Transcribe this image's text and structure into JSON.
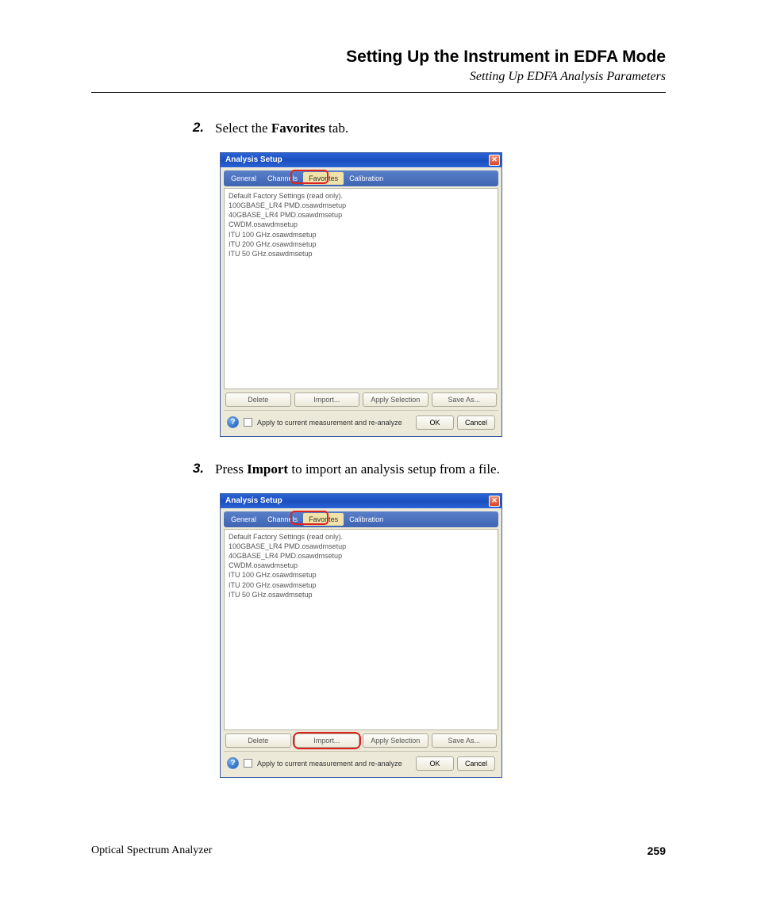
{
  "header": {
    "title": "Setting Up the Instrument in EDFA Mode",
    "subtitle": "Setting Up EDFA Analysis Parameters"
  },
  "steps": {
    "s2": {
      "num": "2.",
      "pre": "Select the ",
      "bold": "Favorites",
      "post": " tab."
    },
    "s3": {
      "num": "3.",
      "pre": "Press ",
      "bold": "Import",
      "post": " to import an analysis setup from a file."
    }
  },
  "dialog": {
    "title": "Analysis Setup",
    "tabs": {
      "general": "General",
      "channels": "Channels",
      "favorites": "Favorites",
      "calibration": "Calibration"
    },
    "list": [
      "Default Factory Settings (read only).",
      "100GBASE_LR4 PMD.osawdmsetup",
      "40GBASE_LR4 PMD.osawdmsetup",
      "CWDM.osawdmsetup",
      "ITU 100 GHz.osawdmsetup",
      "ITU 200 GHz.osawdmsetup",
      "ITU 50 GHz.osawdmsetup"
    ],
    "buttons": {
      "delete": "Delete",
      "import": "Import...",
      "apply": "Apply Selection",
      "saveas": "Save As..."
    },
    "footer": {
      "checkbox_label": "Apply to current measurement and re-analyze",
      "ok": "OK",
      "cancel": "Cancel"
    }
  },
  "page_footer": {
    "left": "Optical Spectrum Analyzer",
    "right": "259"
  }
}
